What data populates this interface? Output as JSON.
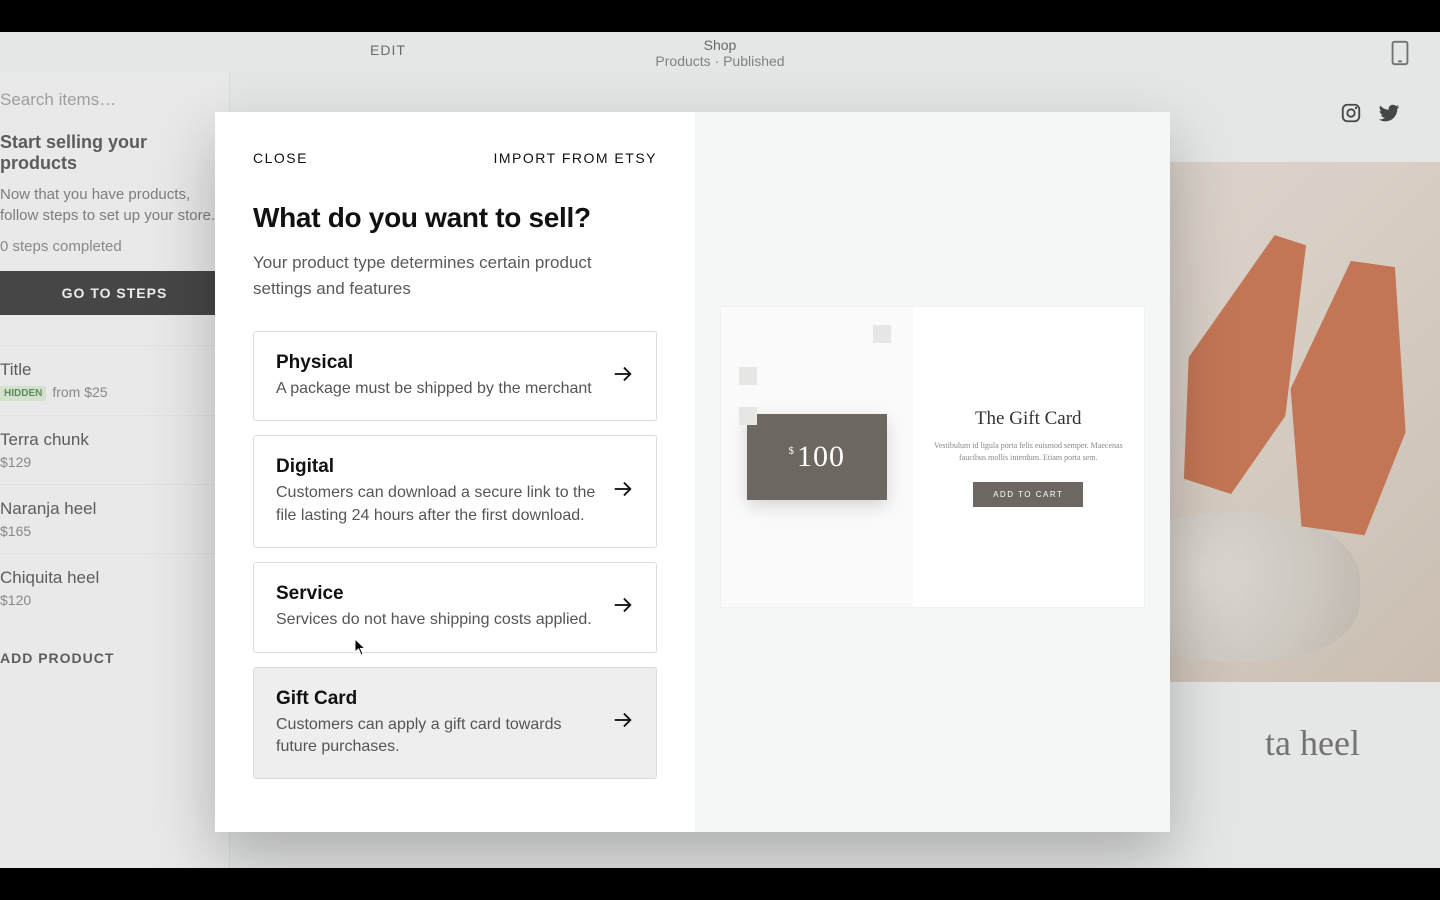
{
  "letterbox": true,
  "editor": {
    "edit_label": "EDIT",
    "page_title": "Shop",
    "breadcrumb": "Products · Published"
  },
  "sidebar": {
    "search_placeholder": "Search items…",
    "promo_title": "Start selling your products",
    "promo_text": "Now that you have products, follow steps to set up your store.",
    "steps_completed": "0 steps completed",
    "gotosteps_label": "GO TO STEPS",
    "featured": {
      "title": "Title",
      "badge": "HIDDEN",
      "price": "from $25"
    },
    "products": [
      {
        "name": "Terra chunk",
        "price": "$129"
      },
      {
        "name": "Naranja heel",
        "price": "$165"
      },
      {
        "name": "Chiquita heel",
        "price": "$120"
      }
    ],
    "add_product_label": "ADD PRODUCT"
  },
  "hero_caption": "ta heel",
  "modal": {
    "close_label": "CLOSE",
    "import_label": "IMPORT FROM ETSY",
    "title": "What do you want to sell?",
    "subtitle": "Your product type determines certain product settings and features",
    "options": [
      {
        "title": "Physical",
        "desc": "A package must be shipped by the merchant"
      },
      {
        "title": "Digital",
        "desc": "Customers can download a secure link to the file lasting 24 hours after the first download."
      },
      {
        "title": "Service",
        "desc": "Services do not have shipping costs applied."
      },
      {
        "title": "Gift Card",
        "desc": "Customers can apply a gift card towards future purchases."
      }
    ],
    "preview": {
      "card_amount": "100",
      "card_currency": "$",
      "title": "The Gift Card",
      "lorem": "Vestibulum id ligula porta felis euismod semper. Maecenas faucibus mollis interdum. Etiam porta sem.",
      "button": "ADD TO CART"
    }
  }
}
